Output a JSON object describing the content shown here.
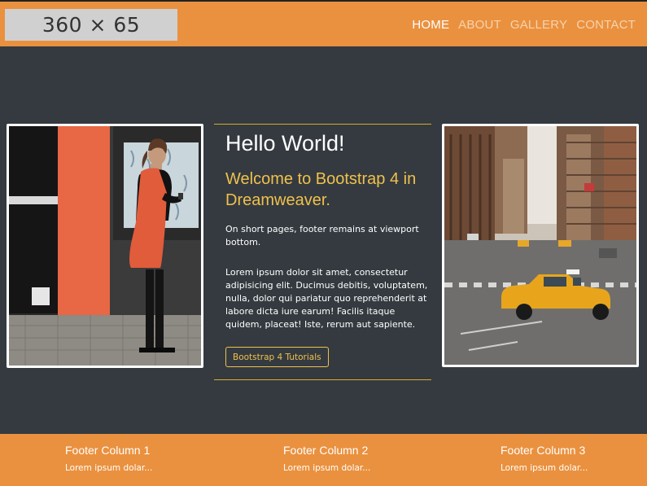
{
  "header": {
    "logo_text": "360 × 65",
    "nav": {
      "home": "HOME",
      "about": "ABOUT",
      "gallery": "GALLERY",
      "contact": "CONTACT"
    }
  },
  "main": {
    "heading": "Hello World!",
    "subheading": "Welcome to Bootstrap 4 in Dreamweaver.",
    "short_text": "On short pages, footer remains at viewport bottom.",
    "lorem_text": "Lorem ipsum dolor sit amet, consectetur adipisicing elit. Ducimus debitis, voluptatem, nulla, dolor qui pariatur quo reprehenderit at labore dicta iure earum! Facilis itaque quidem, placeat! Iste, rerum aut sapiente.",
    "button_label": "Bootstrap 4 Tutorials"
  },
  "footer": {
    "columns": [
      {
        "title": "Footer Column 1",
        "text": "Lorem ipsum dolar..."
      },
      {
        "title": "Footer Column 2",
        "text": "Lorem ipsum dolar..."
      },
      {
        "title": "Footer Column 3",
        "text": "Lorem ipsum dolar..."
      }
    ]
  },
  "colors": {
    "accent": "#ea913f",
    "background": "#343a40",
    "gold": "#f0c14b"
  }
}
